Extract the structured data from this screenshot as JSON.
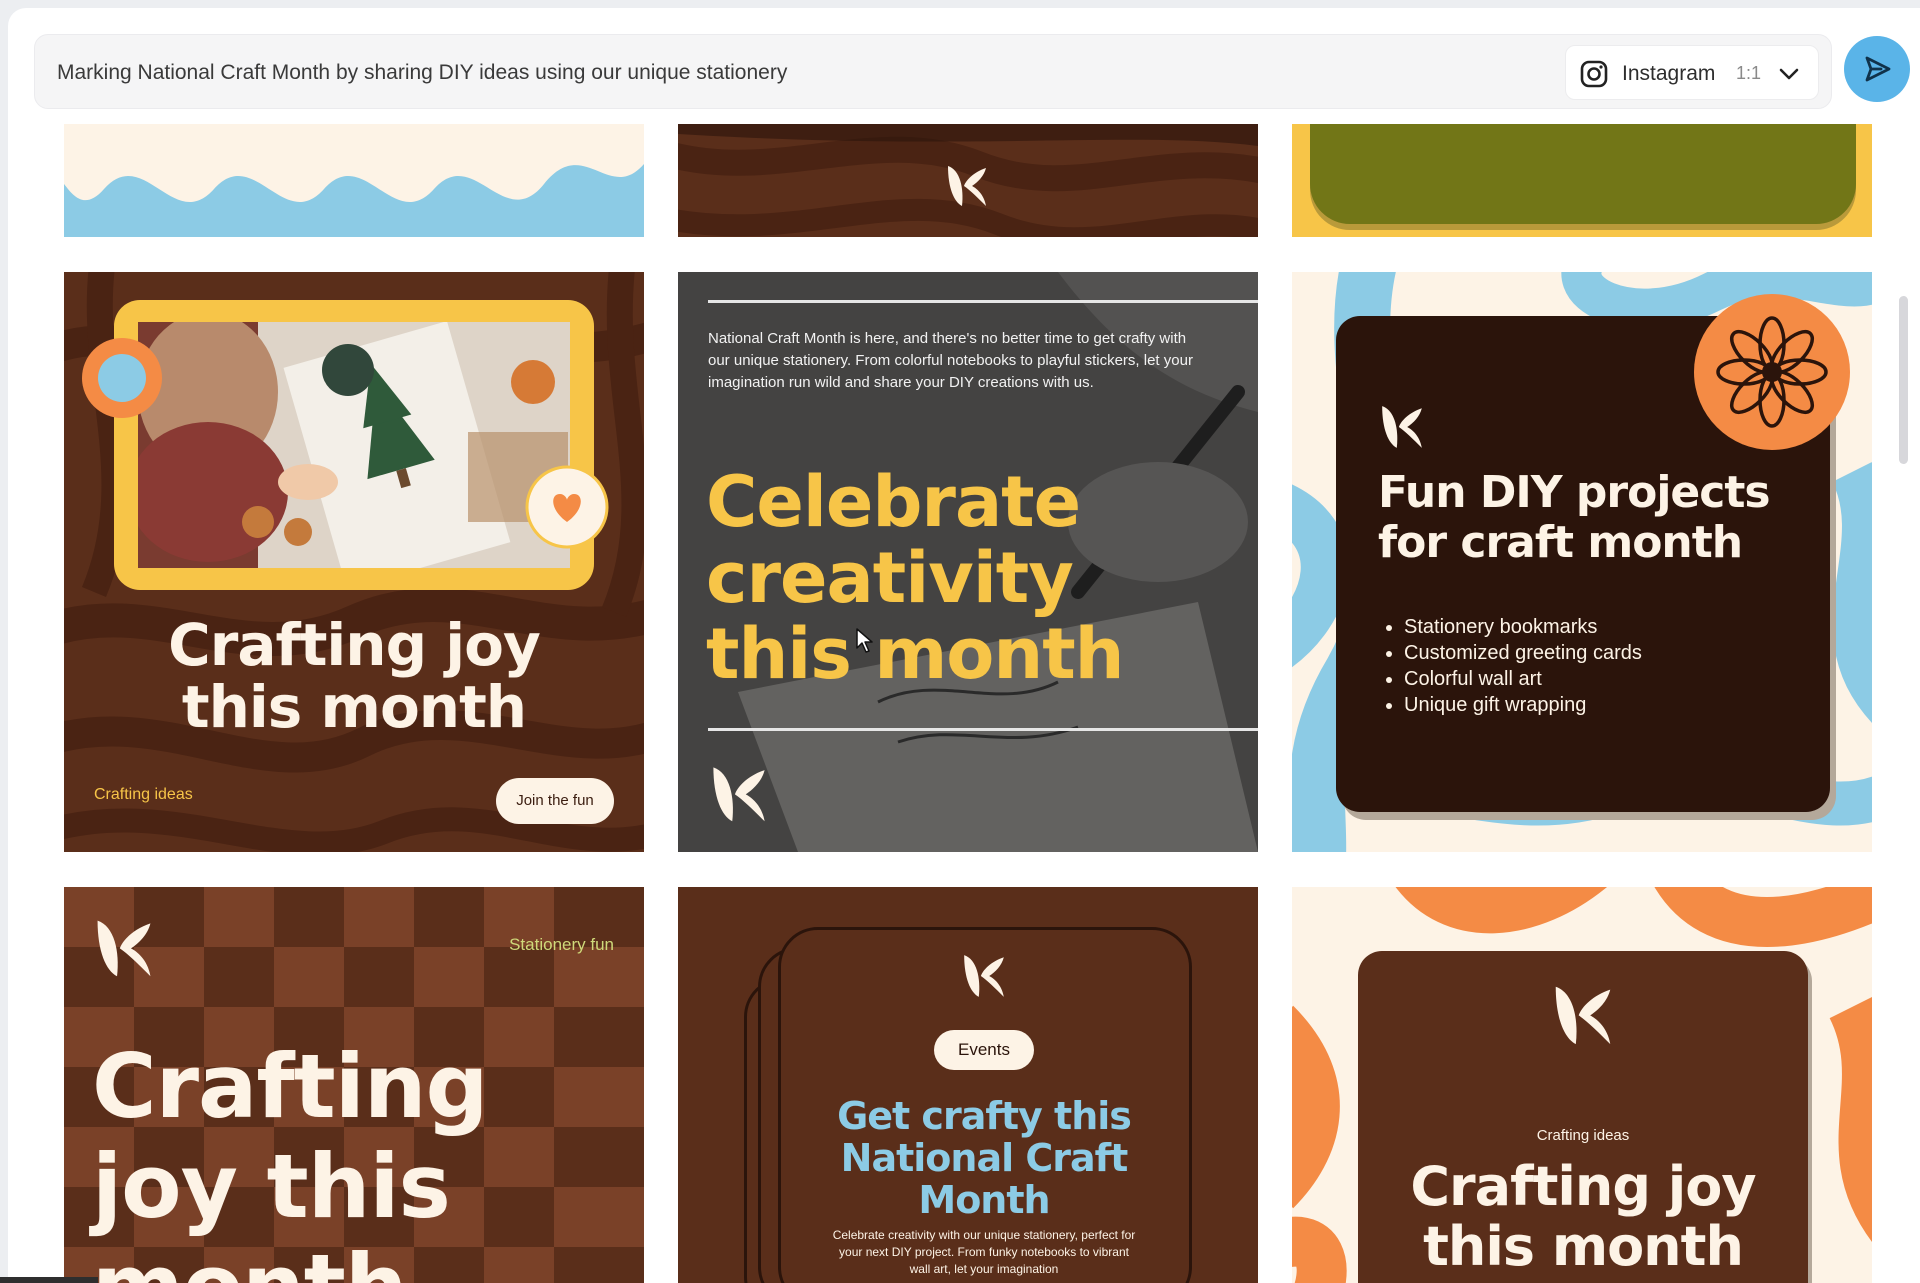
{
  "prompt": {
    "text": "Marking National Craft Month by sharing DIY ideas using our unique stationery",
    "platform": "Instagram",
    "ratio": "1:1",
    "instagram_icon": "instagram-icon",
    "dropdown_icon": "chevron-down-icon",
    "send_icon": "send-icon"
  },
  "colors": {
    "brown": "#5a2e1a",
    "dark_brown": "#2b140b",
    "yellow": "#f7c548",
    "cream": "#fdf3e6",
    "blue": "#8ccbe5",
    "orange": "#f48b45",
    "accent_blue": "#5ab4e8"
  },
  "cards": {
    "card4": {
      "headline": "Crafting joy this month",
      "footer_label": "Crafting ideas",
      "button": "Join the fun"
    },
    "card5": {
      "body": "National Craft Month is here, and there's no better time to get crafty with our unique stationery. From colorful notebooks to playful stickers, let your imagination run wild and share your DIY creations with us.",
      "headline": "Celebrate creativity this month"
    },
    "card6": {
      "headline": "Fun DIY projects for craft month",
      "bullets": [
        "Stationery bookmarks",
        "Customized greeting cards",
        "Colorful wall art",
        "Unique gift wrapping"
      ]
    },
    "card7": {
      "label": "Stationery fun",
      "headline": "Crafting joy this month"
    },
    "card8": {
      "pill": "Events",
      "headline": "Get crafty this National Craft Month",
      "body": "Celebrate creativity with our unique stationery, perfect for your next DIY project. From funky notebooks to vibrant wall art, let your imagination"
    },
    "card9": {
      "label": "Crafting ideas",
      "headline": "Crafting joy this month"
    }
  }
}
